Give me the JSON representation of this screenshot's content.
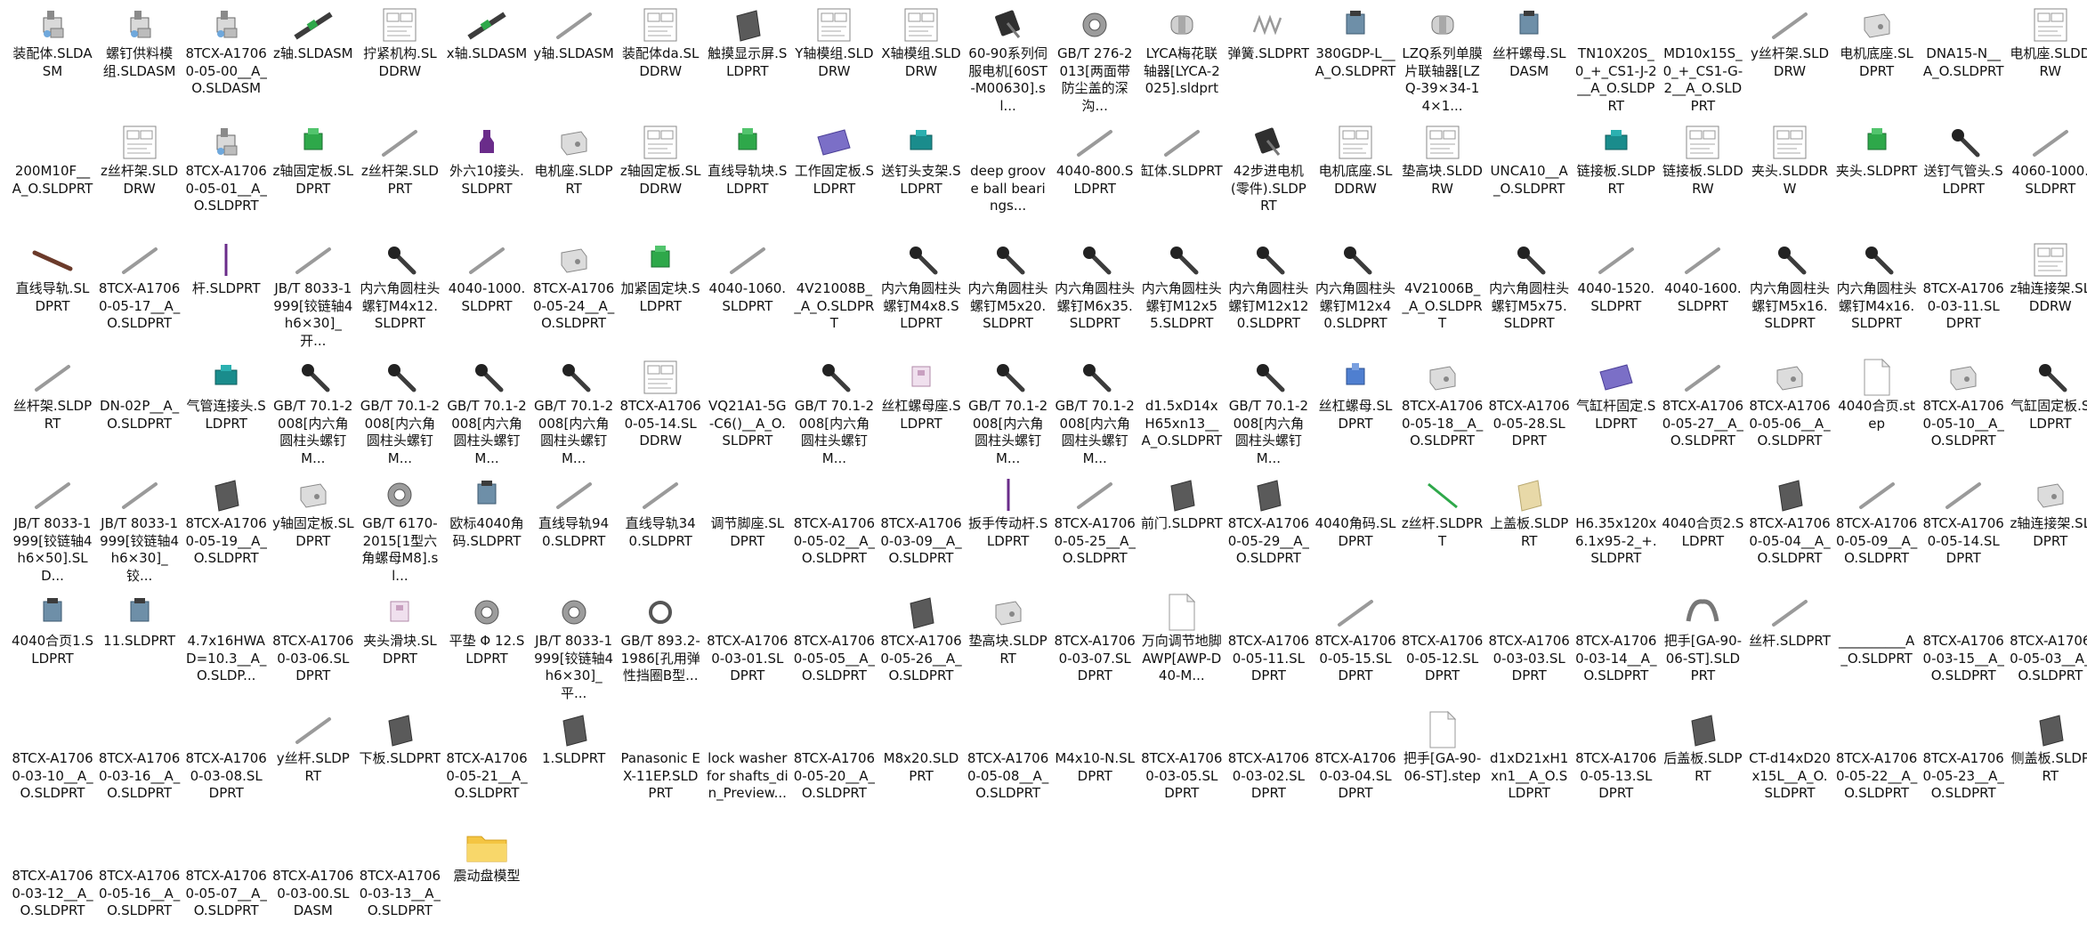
{
  "window": {
    "view": "large-icons",
    "colors": {
      "background": "#ffffff",
      "text": "#111111",
      "part_dark": "#3c3c3c",
      "part_steel": "#9a9a9a",
      "accent_green": "#2ea84a",
      "accent_teal": "#1a8c8c",
      "accent_purple": "#6a2c8a",
      "accent_brown": "#6b3a2a",
      "folder_yellow": "#f4c542"
    }
  },
  "files": [
    {
      "label": "装配体.SLDASM",
      "icon": "assembly-icon"
    },
    {
      "label": "螺钉供料模组.SLDASM",
      "icon": "assembly-icon"
    },
    {
      "label": "8TCX-A17060-05-00__A_O.SLDASM",
      "icon": "assembly-icon"
    },
    {
      "label": "z轴.SLDASM",
      "icon": "rail-assembly-icon"
    },
    {
      "label": "拧紧机构.SLDDRW",
      "icon": "drawing-icon"
    },
    {
      "label": "x轴.SLDASM",
      "icon": "rail-assembly-icon"
    },
    {
      "label": "y轴.SLDASM",
      "icon": "rail-icon"
    },
    {
      "label": "装配体da.SLDDRW",
      "icon": "drawing-icon"
    },
    {
      "label": "触摸显示屏.SLDPRT",
      "icon": "plate-icon"
    },
    {
      "label": "Y轴模组.SLDDRW",
      "icon": "drawing-icon"
    },
    {
      "label": "X轴模组.SLDDRW",
      "icon": "drawing-icon"
    },
    {
      "label": "60-90系列伺服电机[60ST-M00630].sl...",
      "icon": "motor-icon"
    },
    {
      "label": "GB∕T 276-2013[两面带防尘盖的深沟...",
      "icon": "bearing-icon"
    },
    {
      "label": "LYCA梅花联轴器[LYCA-2025].sldprt",
      "icon": "coupling-icon"
    },
    {
      "label": "弹簧.SLDPRT",
      "icon": "spring-icon"
    },
    {
      "label": "380GDP-L__A_O.SLDPRT",
      "icon": "part-icon"
    },
    {
      "label": "LZQ系列单膜片联轴器[LZQ-39×34-14×1...",
      "icon": "coupling-icon"
    },
    {
      "label": "丝杆螺母.SLDASM",
      "icon": "part-icon"
    },
    {
      "label": "TN10X20S_0_+_CS1-J-2__A_O.SLDPRT",
      "icon": "blank-icon"
    },
    {
      "label": "MD10x15S_0_+_CS1-G-2__A_O.SLDPRT",
      "icon": "blank-icon"
    },
    {
      "label": "y丝杆架.SLDDRW",
      "icon": "rail-icon"
    },
    {
      "label": "电机底座.SLDPRT",
      "icon": "bracket-icon"
    },
    {
      "label": "DNA15-N__A_O.SLDPRT",
      "icon": "blank-icon"
    },
    {
      "label": "电机座.SLDDRW",
      "icon": "drawing-icon"
    },
    {
      "label": "200M10F__A_O.SLDPRT",
      "icon": "blank-icon"
    },
    {
      "label": "z丝杆架.SLDDRW",
      "icon": "drawing-icon"
    },
    {
      "label": "8TCX-A17060-05-01__A_O.SLDPRT",
      "icon": "assembly-icon"
    },
    {
      "label": "z轴固定板.SLDPRT",
      "icon": "green-block-icon"
    },
    {
      "label": "z丝杆架.SLDPRT",
      "icon": "rail-icon"
    },
    {
      "label": "外六10接头.SLDPRT",
      "icon": "purple-fitting-icon"
    },
    {
      "label": "电机座.SLDPRT",
      "icon": "bracket-icon"
    },
    {
      "label": "z轴固定板.SLDDRW",
      "icon": "drawing-icon"
    },
    {
      "label": "直线导轨块.SLDPRT",
      "icon": "green-block-icon"
    },
    {
      "label": "工作固定板.SLDPRT",
      "icon": "purple-plate-icon"
    },
    {
      "label": "送钉头支架.SLDPRT",
      "icon": "teal-block-icon"
    },
    {
      "label": "deep groove ball bearings...",
      "icon": "blank-icon"
    },
    {
      "label": "4040-800.SLDPRT",
      "icon": "rail-icon"
    },
    {
      "label": "缸体.SLDPRT",
      "icon": "rail-icon"
    },
    {
      "label": "42步进电机(零件).SLDPRT",
      "icon": "motor-icon"
    },
    {
      "label": "电机底座.SLDDRW",
      "icon": "drawing-icon"
    },
    {
      "label": "垫高块.SLDDRW",
      "icon": "drawing-icon"
    },
    {
      "label": "UNCA10__A_O.SLDPRT",
      "icon": "blank-icon"
    },
    {
      "label": "链接板.SLDPRT",
      "icon": "teal-block-icon"
    },
    {
      "label": "链接板.SLDDRW",
      "icon": "drawing-icon"
    },
    {
      "label": "夹头.SLDDRW",
      "icon": "drawing-icon"
    },
    {
      "label": "夹头.SLDPRT",
      "icon": "green-block-icon"
    },
    {
      "label": "送钉气管头.SLDPRT",
      "icon": "bolt-icon"
    },
    {
      "label": "4060-1000.SLDPRT",
      "icon": "rail-icon"
    },
    {
      "label": "直线导轨.SLDPRT",
      "icon": "brown-rail-icon"
    },
    {
      "label": "8TCX-A17060-05-17__A_O.SLDPRT",
      "icon": "rail-icon"
    },
    {
      "label": "杆.SLDPRT",
      "icon": "purple-rod-icon"
    },
    {
      "label": "JB∕T 8033-1999[铰链轴4h6×30]_开...",
      "icon": "rail-icon"
    },
    {
      "label": "内六角圆柱头螺钉M4x12.SLDPRT",
      "icon": "bolt-icon"
    },
    {
      "label": "4040-1000.SLDPRT",
      "icon": "rail-icon"
    },
    {
      "label": "8TCX-A17060-05-24__A_O.SLDPRT",
      "icon": "bracket-icon"
    },
    {
      "label": "加紧固定块.SLDPRT",
      "icon": "green-block-icon"
    },
    {
      "label": "4040-1060.SLDPRT",
      "icon": "rail-icon"
    },
    {
      "label": "4V21008B__A_O.SLDPRT",
      "icon": "blank-icon"
    },
    {
      "label": "内六角圆柱头螺钉M4x8.SLDPRT",
      "icon": "bolt-icon"
    },
    {
      "label": "内六角圆柱头螺钉M5x20.SLDPRT",
      "icon": "bolt-icon"
    },
    {
      "label": "内六角圆柱头螺钉M6x35.SLDPRT",
      "icon": "bolt-icon"
    },
    {
      "label": "内六角圆柱头螺钉M12x55.SLDPRT",
      "icon": "bolt-icon"
    },
    {
      "label": "内六角圆柱头螺钉M12x120.SLDPRT",
      "icon": "bolt-icon"
    },
    {
      "label": "内六角圆柱头螺钉M12x40.SLDPRT",
      "icon": "bolt-icon"
    },
    {
      "label": "4V21006B__A_O.SLDPRT",
      "icon": "blank-icon"
    },
    {
      "label": "内六角圆柱头螺钉M5x75.SLDPRT",
      "icon": "bolt-icon"
    },
    {
      "label": "4040-1520.SLDPRT",
      "icon": "rail-icon"
    },
    {
      "label": "4040-1600.SLDPRT",
      "icon": "rail-icon"
    },
    {
      "label": "内六角圆柱头螺钉M5x16.SLDPRT",
      "icon": "bolt-icon"
    },
    {
      "label": "内六角圆柱头螺钉M4x16.SLDPRT",
      "icon": "bolt-icon"
    },
    {
      "label": "8TCX-A17060-03-11.SLDPRT",
      "icon": "blank-icon"
    },
    {
      "label": "z轴连接架.SLDDRW",
      "icon": "drawing-icon"
    },
    {
      "label": "丝杆架.SLDPRT",
      "icon": "rail-icon"
    },
    {
      "label": "DN-02P__A_O.SLDPRT",
      "icon": "blank-icon"
    },
    {
      "label": "气管连接头.SLDPRT",
      "icon": "teal-block-icon"
    },
    {
      "label": "GB∕T 70.1-2008[内六角圆柱头螺钉M...",
      "icon": "bolt-icon"
    },
    {
      "label": "GB∕T 70.1-2008[内六角圆柱头螺钉M...",
      "icon": "bolt-icon"
    },
    {
      "label": "GB∕T 70.1-2008[内六角圆柱头螺钉M...",
      "icon": "bolt-icon"
    },
    {
      "label": "GB∕T 70.1-2008[内六角圆柱头螺钉M...",
      "icon": "bolt-icon"
    },
    {
      "label": "8TCX-A17060-05-14.SLDDRW",
      "icon": "drawing-icon"
    },
    {
      "label": "VQ21A1-5G-C6()__A_O.SLDPRT",
      "icon": "blank-icon"
    },
    {
      "label": "GB∕T 70.1-2008[内六角圆柱头螺钉M...",
      "icon": "bolt-icon"
    },
    {
      "label": "丝杠螺母座.SLDPRT",
      "icon": "pink-block-icon"
    },
    {
      "label": "GB∕T 70.1-2008[内六角圆柱头螺钉M...",
      "icon": "bolt-icon"
    },
    {
      "label": "GB∕T 70.1-2008[内六角圆柱头螺钉M...",
      "icon": "bolt-icon"
    },
    {
      "label": "d1.5xD14xH65xn13__A_O.SLDPRT",
      "icon": "blank-icon"
    },
    {
      "label": "GB∕T 70.1-2008[内六角圆柱头螺钉M...",
      "icon": "bolt-icon"
    },
    {
      "label": "丝杠螺母.SLDPRT",
      "icon": "blue-part-icon"
    },
    {
      "label": "8TCX-A17060-05-18__A_O.SLDPRT",
      "icon": "bracket-icon"
    },
    {
      "label": "8TCX-A17060-05-28.SLDPRT",
      "icon": "blank-icon"
    },
    {
      "label": "气缸杆固定.SLDPRT",
      "icon": "purple-plate-icon"
    },
    {
      "label": "8TCX-A17060-05-27__A_O.SLDPRT",
      "icon": "rail-icon"
    },
    {
      "label": "8TCX-A17060-05-06__A_O.SLDPRT",
      "icon": "bracket-icon"
    },
    {
      "label": "4040合页.step",
      "icon": "document-icon"
    },
    {
      "label": "8TCX-A17060-05-10__A_O.SLDPRT",
      "icon": "bracket-icon"
    },
    {
      "label": "气缸固定板.SLDPRT",
      "icon": "bolt-icon"
    },
    {
      "label": "JB∕T 8033-1999[铰链轴4h6×50].SLD...",
      "icon": "rail-icon"
    },
    {
      "label": "JB∕T 8033-1999[铰链轴4h6×30]_铰...",
      "icon": "rail-icon"
    },
    {
      "label": "8TCX-A17060-05-19__A_O.SLDPRT",
      "icon": "plate-icon"
    },
    {
      "label": "y轴固定板.SLDPRT",
      "icon": "bracket-icon"
    },
    {
      "label": "GB∕T 6170-2015[1型六角螺母M8].sl...",
      "icon": "bearing-icon"
    },
    {
      "label": "欧标4040角码.SLDPRT",
      "icon": "part-icon"
    },
    {
      "label": "直线导轨940.SLDPRT",
      "icon": "rail-icon"
    },
    {
      "label": "直线导轨340.SLDPRT",
      "icon": "rail-icon"
    },
    {
      "label": "调节脚座.SLDPRT",
      "icon": "blank-icon"
    },
    {
      "label": "8TCX-A17060-05-02__A_O.SLDPRT",
      "icon": "blank-icon"
    },
    {
      "label": "8TCX-A17060-03-09__A_O.SLDPRT",
      "icon": "blank-icon"
    },
    {
      "label": "扳手传动杆.SLDPRT",
      "icon": "purple-rod-icon"
    },
    {
      "label": "8TCX-A17060-05-25__A_O.SLDPRT",
      "icon": "rail-icon"
    },
    {
      "label": "前门.SLDPRT",
      "icon": "plate-icon"
    },
    {
      "label": "8TCX-A17060-05-29__A_O.SLDPRT",
      "icon": "plate-icon"
    },
    {
      "label": "4040角码.SLDPRT",
      "icon": "blank-icon"
    },
    {
      "label": "z丝杆.SLDPRT",
      "icon": "green-rod-icon"
    },
    {
      "label": "上盖板.SLDPRT",
      "icon": "tan-plate-icon"
    },
    {
      "label": "H6.35x120x6.1x95-2_+.SLDPRT",
      "icon": "blank-icon"
    },
    {
      "label": "4040合页2.SLDPRT",
      "icon": "blank-icon"
    },
    {
      "label": "8TCX-A17060-05-04__A_O.SLDPRT",
      "icon": "plate-icon"
    },
    {
      "label": "8TCX-A17060-05-09__A_O.SLDPRT",
      "icon": "rail-icon"
    },
    {
      "label": "8TCX-A17060-05-14.SLDPRT",
      "icon": "rail-icon"
    },
    {
      "label": "z轴连接架.SLDPRT",
      "icon": "bracket-icon"
    },
    {
      "label": "4040合页1.SLDPRT",
      "icon": "part-icon"
    },
    {
      "label": "11.SLDPRT",
      "icon": "part-icon"
    },
    {
      "label": "4.7x16HWAD=10.3__A_O.SLDP...",
      "icon": "blank-icon"
    },
    {
      "label": "8TCX-A17060-03-06.SLDPRT",
      "icon": "blank-icon"
    },
    {
      "label": "夹头滑块.SLDPRT",
      "icon": "pink-block-icon"
    },
    {
      "label": "平垫 Φ 12.SLDPRT",
      "icon": "bearing-icon"
    },
    {
      "label": "JB∕T 8033-1999[铰链轴4h6×30]_平...",
      "icon": "bearing-icon"
    },
    {
      "label": "GB∕T 893.2-1986[孔用弹性挡圈B型...",
      "icon": "ring-icon"
    },
    {
      "label": "8TCX-A17060-03-01.SLDPRT",
      "icon": "blank-icon"
    },
    {
      "label": "8TCX-A17060-05-05__A_O.SLDPRT",
      "icon": "blank-icon"
    },
    {
      "label": "8TCX-A17060-05-26__A_O.SLDPRT",
      "icon": "plate-icon"
    },
    {
      "label": "垫高块.SLDPRT",
      "icon": "bracket-icon"
    },
    {
      "label": "8TCX-A17060-03-07.SLDPRT",
      "icon": "blank-icon"
    },
    {
      "label": "万向调节地脚AWP[AWP-D40-M...",
      "icon": "document-icon"
    },
    {
      "label": "8TCX-A17060-05-11.SLDPRT",
      "icon": "blank-icon"
    },
    {
      "label": "8TCX-A17060-05-15.SLDPRT",
      "icon": "rail-icon"
    },
    {
      "label": "8TCX-A17060-05-12.SLDPRT",
      "icon": "blank-icon"
    },
    {
      "label": "8TCX-A17060-03-03.SLDPRT",
      "icon": "blank-icon"
    },
    {
      "label": "8TCX-A17060-03-14__A_O.SLDPRT",
      "icon": "blank-icon"
    },
    {
      "label": "把手[GA-90-06-ST].SLDPRT",
      "icon": "handle-icon"
    },
    {
      "label": "丝杆.SLDPRT",
      "icon": "rail-icon"
    },
    {
      "label": "__________A_O.SLDPRT",
      "icon": "blank-icon"
    },
    {
      "label": "8TCX-A17060-03-15__A_O.SLDPRT",
      "icon": "blank-icon"
    },
    {
      "label": "8TCX-A17060-05-03__A_O.SLDPRT",
      "icon": "blank-icon"
    },
    {
      "label": "8TCX-A17060-03-10__A_O.SLDPRT",
      "icon": "blank-icon"
    },
    {
      "label": "8TCX-A17060-03-16__A_O.SLDPRT",
      "icon": "blank-icon"
    },
    {
      "label": "8TCX-A17060-03-08.SLDPRT",
      "icon": "blank-icon"
    },
    {
      "label": "y丝杆.SLDPRT",
      "icon": "rail-icon"
    },
    {
      "label": "下板.SLDPRT",
      "icon": "plate-icon"
    },
    {
      "label": "8TCX-A17060-05-21__A_O.SLDPRT",
      "icon": "blank-icon"
    },
    {
      "label": "1.SLDPRT",
      "icon": "plate-icon"
    },
    {
      "label": "Panasonic EX-11EP.SLDPRT",
      "icon": "blank-icon"
    },
    {
      "label": "lock washer for shafts_din_Preview...",
      "icon": "blank-icon"
    },
    {
      "label": "8TCX-A17060-05-20__A_O.SLDPRT",
      "icon": "blank-icon"
    },
    {
      "label": "M8x20.SLDPRT",
      "icon": "blank-icon"
    },
    {
      "label": "8TCX-A17060-05-08__A_O.SLDPRT",
      "icon": "blank-icon"
    },
    {
      "label": "M4x10-N.SLDPRT",
      "icon": "blank-icon"
    },
    {
      "label": "8TCX-A17060-03-05.SLDPRT",
      "icon": "blank-icon"
    },
    {
      "label": "8TCX-A17060-03-02.SLDPRT",
      "icon": "blank-icon"
    },
    {
      "label": "8TCX-A17060-03-04.SLDPRT",
      "icon": "blank-icon"
    },
    {
      "label": "把手[GA-90-06-ST].step",
      "icon": "document-icon"
    },
    {
      "label": "d1xD21xH1xn1__A_O.SLDPRT",
      "icon": "blank-icon"
    },
    {
      "label": "8TCX-A17060-05-13.SLDPRT",
      "icon": "blank-icon"
    },
    {
      "label": "后盖板.SLDPRT",
      "icon": "plate-icon"
    },
    {
      "label": "CT-d14xD20x15L__A_O.SLDPRT",
      "icon": "blank-icon"
    },
    {
      "label": "8TCX-A17060-05-22__A_O.SLDPRT",
      "icon": "blank-icon"
    },
    {
      "label": "8TCX-A17060-05-23__A_O.SLDPRT",
      "icon": "blank-icon"
    },
    {
      "label": "侧盖板.SLDPRT",
      "icon": "plate-icon"
    },
    {
      "label": "8TCX-A17060-03-12__A_O.SLDPRT",
      "icon": "blank-icon"
    },
    {
      "label": "8TCX-A17060-05-16__A_O.SLDPRT",
      "icon": "blank-icon"
    },
    {
      "label": "8TCX-A17060-05-07__A_O.SLDPRT",
      "icon": "blank-icon"
    },
    {
      "label": "8TCX-A17060-03-00.SLDASM",
      "icon": "blank-icon"
    },
    {
      "label": "8TCX-A17060-03-13__A_O.SLDPRT",
      "icon": "blank-icon"
    },
    {
      "label": "震动盘模型",
      "icon": "folder-icon"
    }
  ]
}
